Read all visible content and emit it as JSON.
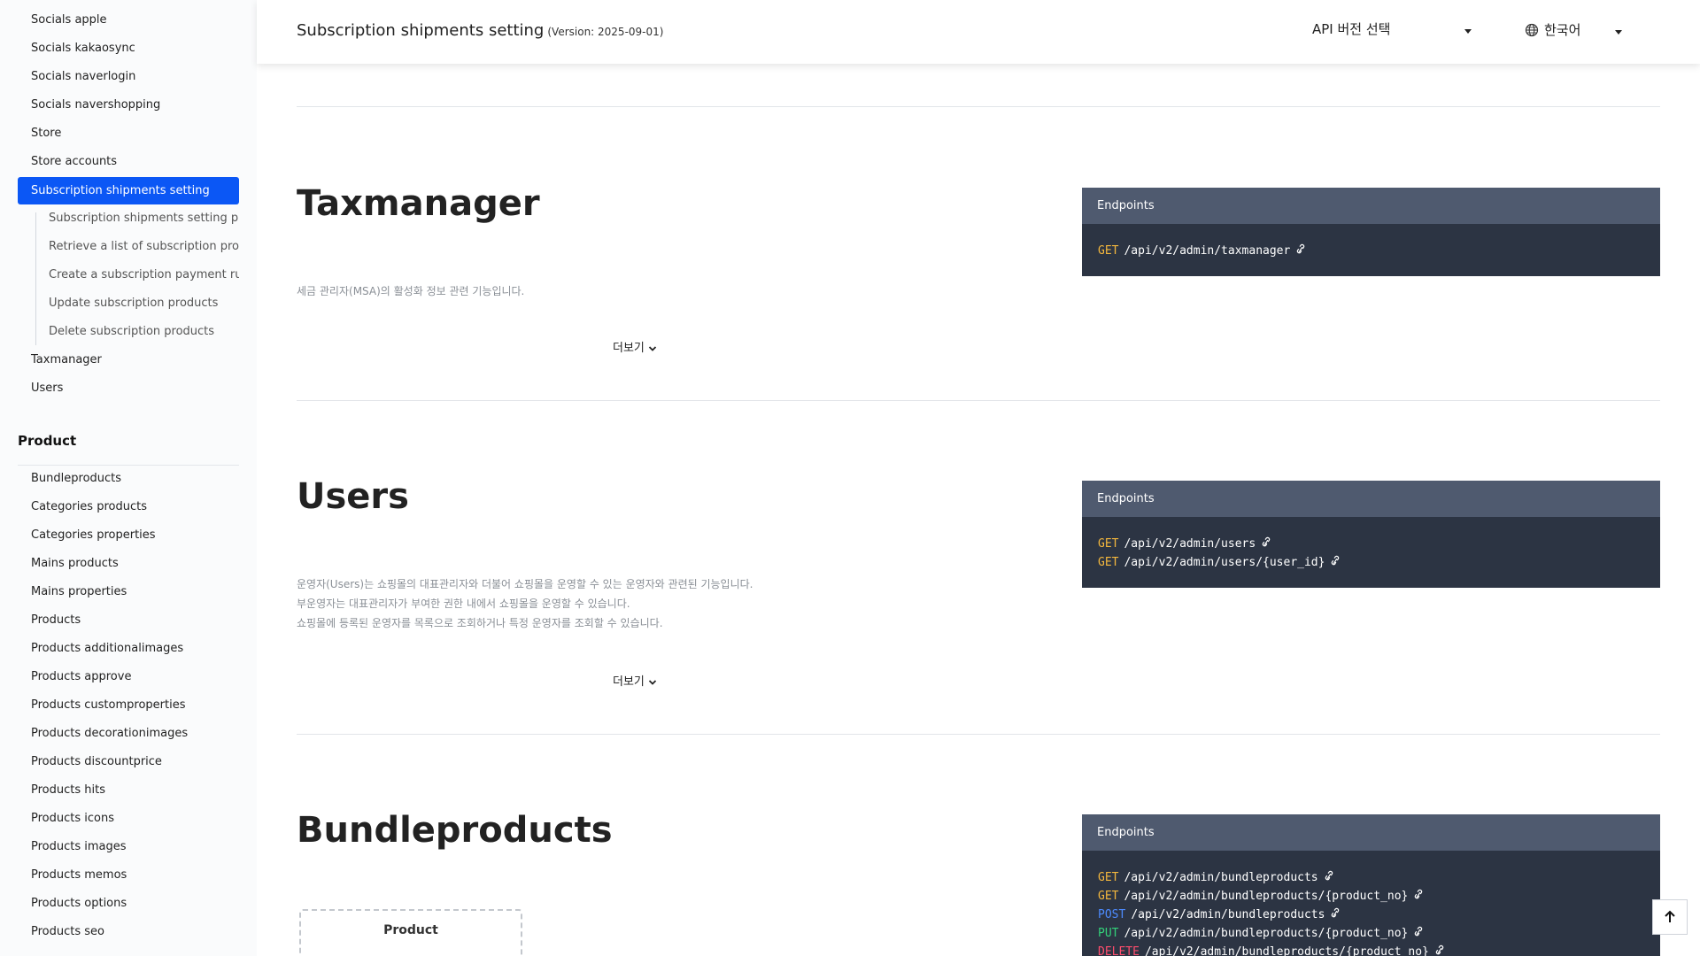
{
  "sidebar": {
    "items_top": [
      "Socials apple",
      "Socials kakaosync",
      "Socials naverlogin",
      "Socials navershopping",
      "Store",
      "Store accounts"
    ],
    "active_item": "Subscription shipments setting",
    "sub_items": [
      "Subscription shipments setting properties",
      "Retrieve a list of subscription products",
      "Create a subscription payment rule",
      "Update subscription products",
      "Delete subscription products"
    ],
    "items_after": [
      "Taxmanager",
      "Users"
    ],
    "section_title": "Product",
    "product_items": [
      "Bundleproducts",
      "Categories products",
      "Categories properties",
      "Mains products",
      "Mains properties",
      "Products",
      "Products additionalimages",
      "Products approve",
      "Products customproperties",
      "Products decorationimages",
      "Products discountprice",
      "Products hits",
      "Products icons",
      "Products images",
      "Products memos",
      "Products options",
      "Products seo"
    ]
  },
  "header": {
    "title": "Subscription shipments setting",
    "version": "(Version: 2025-09-01)",
    "api_select_label": "API 버전 선택",
    "language_label": "한국어"
  },
  "sections": {
    "taxmanager": {
      "title": "Taxmanager",
      "description": [
        "세금 관리자(MSA)의 활성화 정보 관련 기능입니다."
      ],
      "more_label": "더보기",
      "endpoints_label": "Endpoints",
      "endpoints": [
        {
          "method": "GET",
          "path": "/api/v2/admin/taxmanager"
        }
      ]
    },
    "users": {
      "title": "Users",
      "description": [
        "운영자(Users)는 쇼핑몰의 대표관리자와 더불어 쇼핑몰을 운영할 수 있는 운영자와 관련된 기능입니다.",
        "부운영자는 대표관리자가 부여한 권한 내에서 쇼핑몰을 운영할 수 있습니다.",
        "쇼핑몰에 등록된 운영자를 목록으로 조회하거나 특정 운영자를 조회할 수 있습니다."
      ],
      "more_label": "더보기",
      "endpoints_label": "Endpoints",
      "endpoints": [
        {
          "method": "GET",
          "path": "/api/v2/admin/users"
        },
        {
          "method": "GET",
          "path": "/api/v2/admin/users/{user_id}"
        }
      ]
    },
    "bundleproducts": {
      "title": "Bundleproducts",
      "diagram_label": "Product",
      "endpoints_label": "Endpoints",
      "endpoints": [
        {
          "method": "GET",
          "path": "/api/v2/admin/bundleproducts"
        },
        {
          "method": "GET",
          "path": "/api/v2/admin/bundleproducts/{product_no}"
        },
        {
          "method": "POST",
          "path": "/api/v2/admin/bundleproducts"
        },
        {
          "method": "PUT",
          "path": "/api/v2/admin/bundleproducts/{product_no}"
        },
        {
          "method": "DELETE",
          "path": "/api/v2/admin/bundleproducts/{product_no}"
        }
      ]
    }
  },
  "colors": {
    "accent": "#0b57f5",
    "endpoint_header": "#4f5a6f",
    "endpoint_body": "#2c3443",
    "get": "#f5b83d",
    "post": "#4d8bff",
    "put": "#33d17a",
    "delete": "#ff4d6d"
  },
  "icons": {
    "language": "globe-icon",
    "endpoint_link": "link-icon",
    "more": "chevron-down-icon",
    "scroll_top": "arrow-up-icon"
  }
}
